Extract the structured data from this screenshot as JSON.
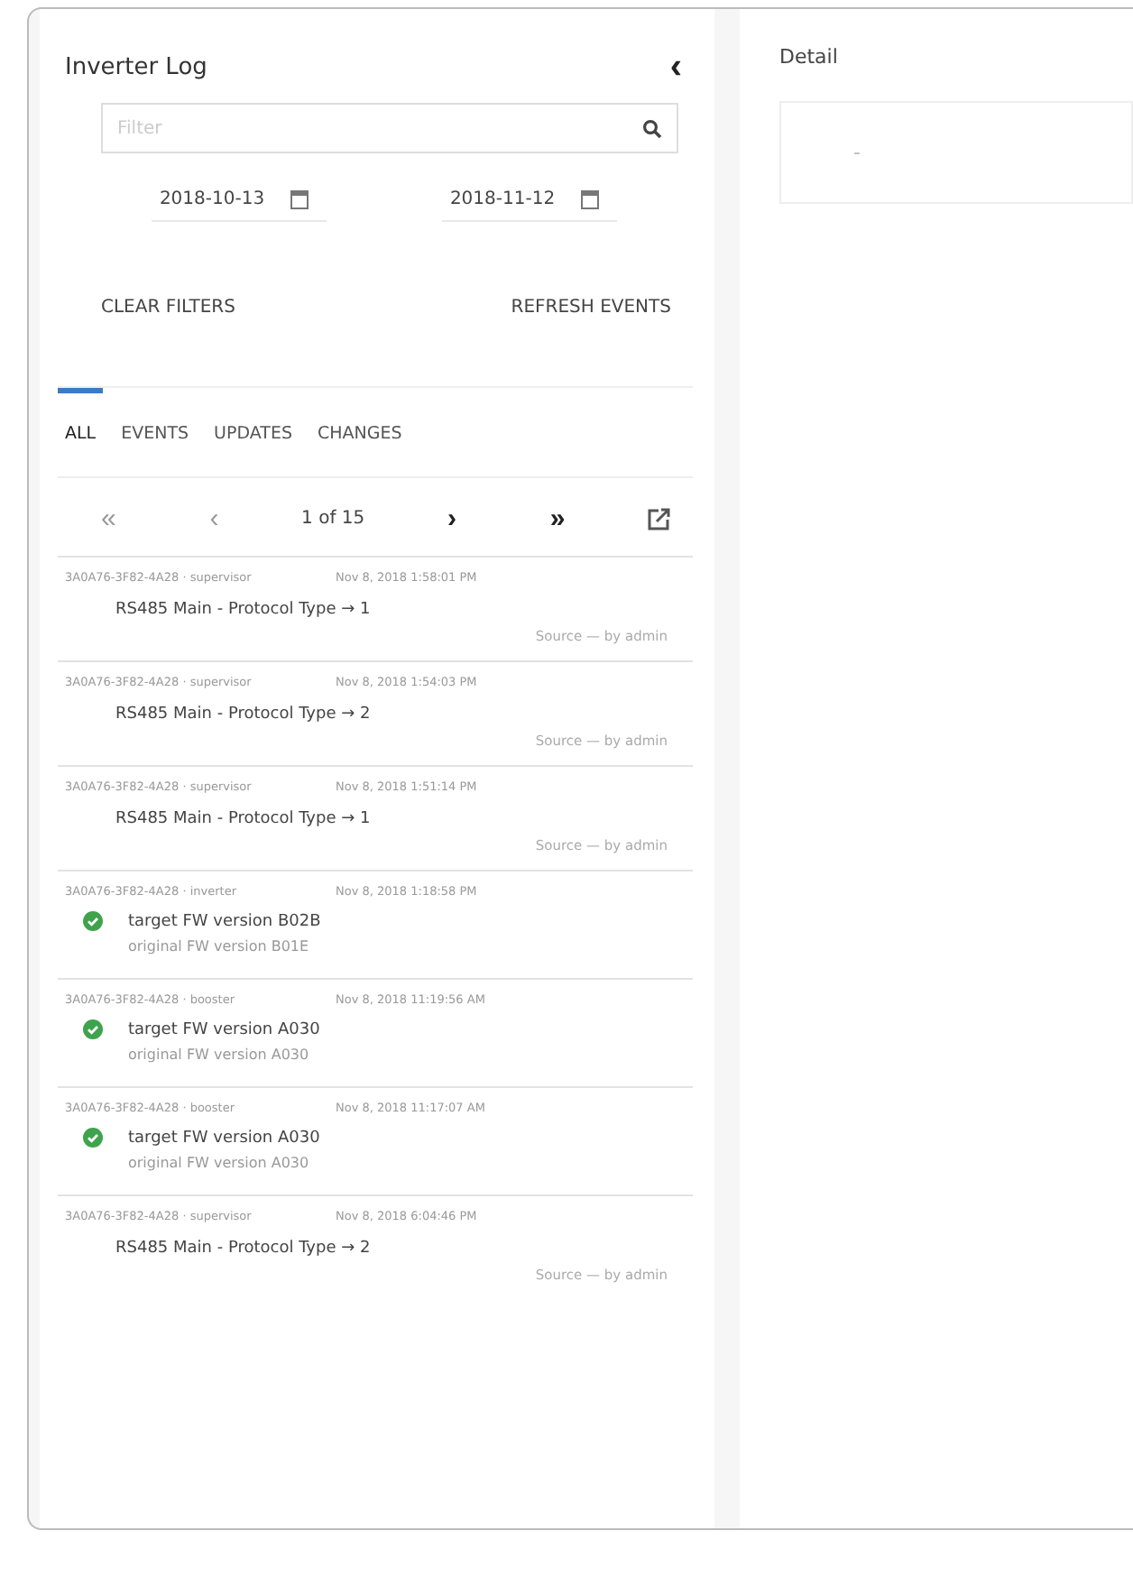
{
  "log_panel": {
    "title": "Inverter Log",
    "collapse": "‹",
    "filter": {
      "placeholder": "Filter"
    },
    "dates": [
      {
        "value": "2018-10-13"
      },
      {
        "value": "2018-11-12"
      }
    ],
    "actions": [
      "CLEAR FILTERS",
      "REFRESH EVENTS"
    ],
    "tabs": [
      {
        "label": "ALL",
        "selected": true
      },
      {
        "label": "EVENTS",
        "selected": false
      },
      {
        "label": "UPDATES",
        "selected": false
      },
      {
        "label": "CHANGES",
        "selected": false
      }
    ],
    "pager": {
      "first": "«",
      "prev": "‹",
      "page": "1 of 15",
      "next": "›",
      "last": "»"
    },
    "entries": [
      {
        "kind": "change",
        "device": "3A0A76-3F82-4A28 · supervisor",
        "time": "Nov 8, 2018 1:58:01 PM",
        "title": "RS485 Main - Protocol Type → 1",
        "source": "Source — by admin"
      },
      {
        "kind": "change",
        "device": "3A0A76-3F82-4A28 · supervisor",
        "time": "Nov 8, 2018 1:54:03 PM",
        "title": "RS485 Main - Protocol Type → 2",
        "source": "Source — by admin"
      },
      {
        "kind": "change",
        "device": "3A0A76-3F82-4A28 · supervisor",
        "time": "Nov 8, 2018 1:51:14 PM",
        "title": "RS485 Main - Protocol Type → 1",
        "source": "Source — by admin"
      },
      {
        "kind": "update",
        "device": "3A0A76-3F82-4A28 · inverter",
        "time": "Nov 8, 2018 1:18:58 PM",
        "title": "target FW version B02B",
        "source": "original FW version B01E"
      },
      {
        "kind": "update",
        "device": "3A0A76-3F82-4A28 · booster",
        "time": "Nov 8, 2018 11:19:56 AM",
        "title": "target FW version A030",
        "source": "original FW version A030"
      },
      {
        "kind": "update",
        "device": "3A0A76-3F82-4A28 · booster",
        "time": "Nov 8, 2018 11:17:07 AM",
        "title": "target FW version A030",
        "source": "original FW version A030"
      },
      {
        "kind": "change",
        "device": "3A0A76-3F82-4A28 · supervisor",
        "time": "Nov 8, 2018 6:04:46 PM",
        "title": "RS485 Main - Protocol Type → 2",
        "source": "Source — by admin"
      }
    ]
  },
  "detail_panel": {
    "title": "Detail",
    "placeholder": "-"
  }
}
